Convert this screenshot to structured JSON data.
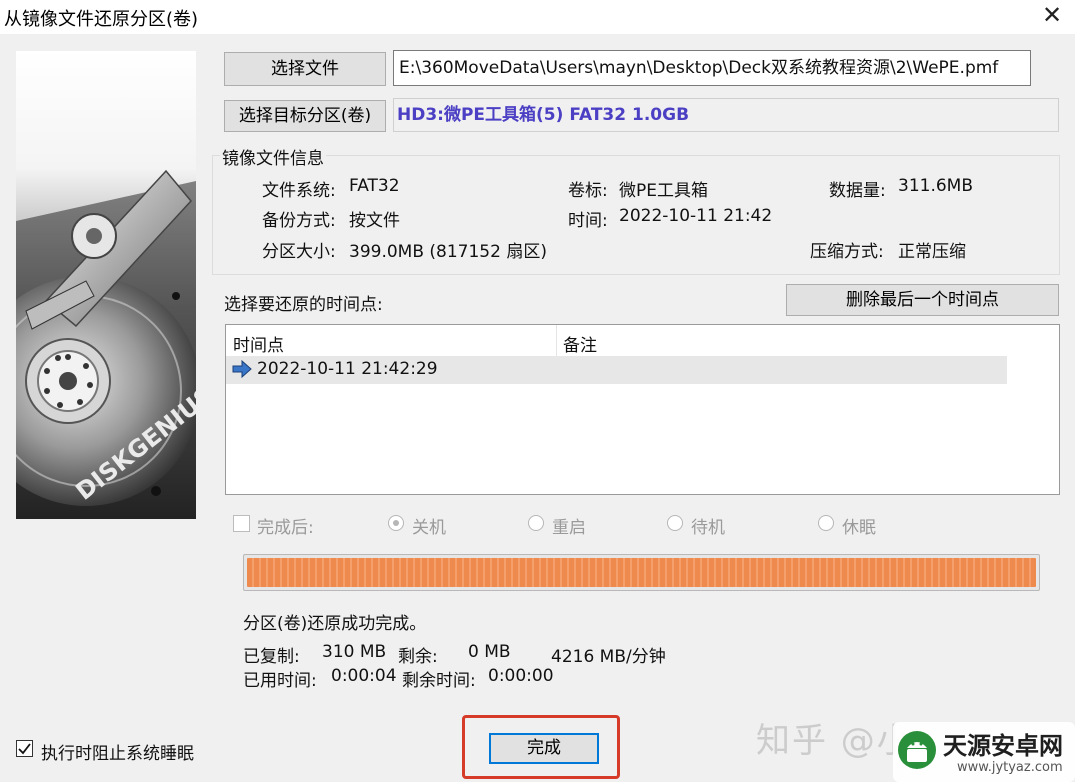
{
  "window": {
    "title": "从镜像文件还原分区(卷)"
  },
  "icons": {
    "close": "close-icon",
    "row_arrow": "arrow-right-icon",
    "brand_logo": "android-logo-icon"
  },
  "hero": {
    "brand": "DISKGENIUS"
  },
  "file": {
    "select_label": "选择文件",
    "path": "E:\\360MoveData\\Users\\mayn\\Desktop\\Deck双系统教程资源\\2\\WePE.pmf"
  },
  "target": {
    "select_label": "选择目标分区(卷)",
    "value": "HD3:微PE工具箱(5) FAT32 1.0GB",
    "value_color": "#4b3fc4"
  },
  "image_info": {
    "title": "镜像文件信息",
    "filesystem_label": "文件系统:",
    "filesystem": "FAT32",
    "volume_label": "卷标:",
    "volume": "微PE工具箱",
    "datasize_label": "数据量:",
    "datasize": "311.6MB",
    "backup_mode_label": "备份方式:",
    "backup_mode": "按文件",
    "time_label": "时间:",
    "time": "2022-10-11 21:42",
    "partition_size_label": "分区大小:",
    "partition_size": "399.0MB  (817152 扇区)",
    "compression_label": "压缩方式:",
    "compression": "正常压缩"
  },
  "timepoints": {
    "prompt": "选择要还原的时间点:",
    "delete_label": "删除最后一个时间点",
    "columns": [
      "时间点",
      "备注"
    ],
    "rows": [
      {
        "time": "2022-10-11 21:42:29",
        "note": ""
      }
    ]
  },
  "after": {
    "label": "完成后:",
    "options": [
      "关机",
      "重启",
      "待机",
      "休眠"
    ],
    "selected": "关机"
  },
  "progress": {
    "fraction": 1.0,
    "color": "#ee8a4e"
  },
  "status": {
    "message": "分区(卷)还原成功完成。",
    "copied_label": "已复制:",
    "copied": "310 MB",
    "remaining_label": "剩余:",
    "remaining": "0 MB",
    "speed": "4216 MB/分钟",
    "elapsed_label": "已用时间:",
    "elapsed": "0:00:04",
    "time_left_label": "剩余时间:",
    "time_left": "0:00:00"
  },
  "footer": {
    "prevent_sleep_label": "执行时阻止系统睡眠",
    "prevent_sleep_checked": true,
    "done_label": "完成"
  },
  "overlay": {
    "zhihu_watermark": "知乎 @小",
    "site_name": "天源安卓网",
    "site_url": "www.jytyaz.com",
    "highlight_color": "#d63b2a"
  }
}
